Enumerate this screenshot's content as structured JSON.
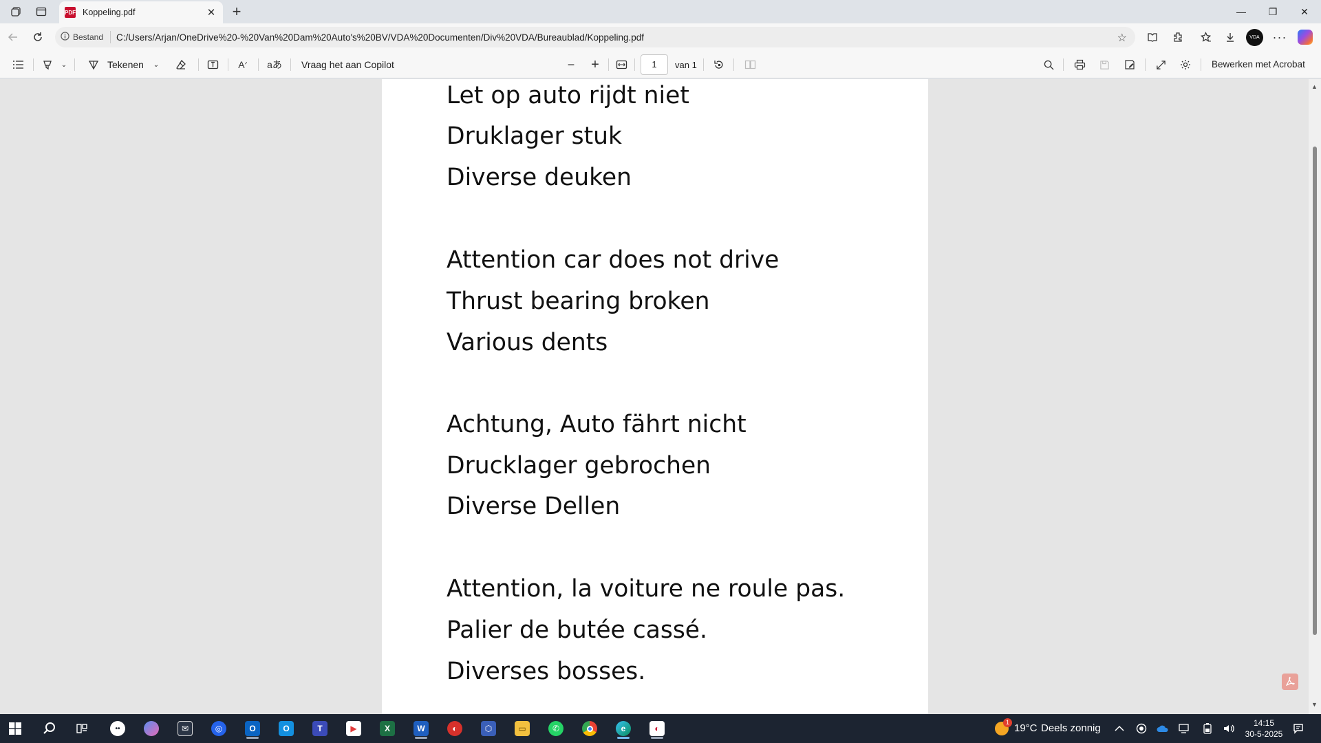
{
  "browser": {
    "tab": {
      "title": "Koppeling.pdf",
      "favicon": "pdf-icon",
      "close_label": "✕"
    },
    "new_tab_label": "+",
    "window_controls": {
      "minimize": "—",
      "restore": "❐",
      "close": "✕"
    },
    "address": {
      "info_label": "Bestand",
      "url": "C:/Users/Arjan/OneDrive%20-%20Van%20Dam%20Auto's%20BV/VDA%20Documenten/Div%20VDA/Bureaublad/Koppeling.pdf"
    },
    "avatar_text": "VDA"
  },
  "pdf_toolbar": {
    "draw_label": "Tekenen",
    "copilot_label": "Vraag het aan Copilot",
    "page_current": "1",
    "page_total": "van 1",
    "edit_acrobat_label": "Bewerken met Acrobat"
  },
  "document": {
    "lines": [
      "Let op auto rijdt niet",
      "Druklager stuk",
      "Diverse deuken",
      "Attention car does not drive",
      "Thrust bearing broken",
      "Various dents",
      "Achtung, Auto fährt nicht",
      "Drucklager gebrochen",
      "Diverse Dellen",
      "Attention, la voiture ne roule pas.",
      "Palier de butée cassé.",
      "Diverses bosses."
    ]
  },
  "taskbar": {
    "weather_temp": "19°C",
    "weather_text": "Deels zonnig",
    "weather_alert": "1",
    "time": "14:15",
    "date": "30-5-2025"
  },
  "colors": {
    "accent": "#0067c0",
    "taskbar_bg": "#1c2431",
    "pdf_red": "#c8102e"
  }
}
